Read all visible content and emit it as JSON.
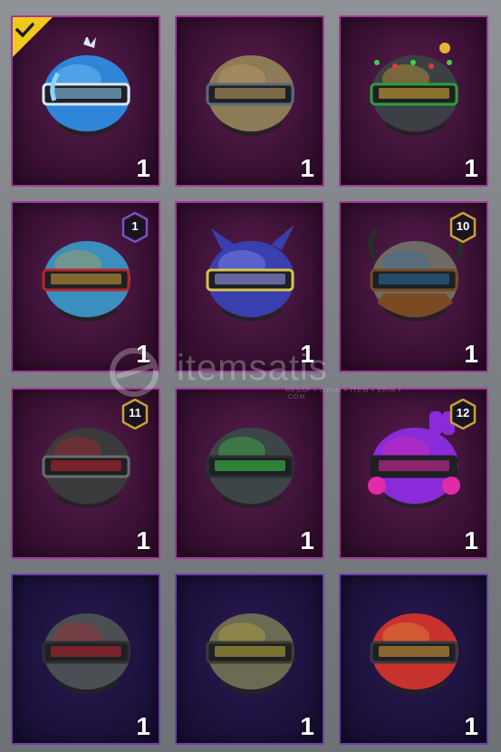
{
  "inventory": {
    "items": [
      {
        "name": "ice-helmet",
        "count": "1",
        "badge": "",
        "selected": true,
        "tone": "purple",
        "colors": {
          "main": "#2f86d8",
          "accent": "#8fd3ff",
          "trim": "#d9e8f5"
        }
      },
      {
        "name": "bronze-knight-helmet",
        "count": "1",
        "badge": "",
        "selected": false,
        "tone": "purple",
        "colors": {
          "main": "#8d7a57",
          "accent": "#c9a56a",
          "trim": "#5b6a78"
        }
      },
      {
        "name": "christmas-lights-helmet",
        "count": "1",
        "badge": "",
        "selected": false,
        "tone": "purple",
        "colors": {
          "main": "#3c3f44",
          "accent": "#e5b531",
          "trim": "#2f9e3a"
        }
      },
      {
        "name": "golden-pharaoh-helmet",
        "count": "1",
        "badge": "1",
        "badge_color": "#7a4fc2",
        "selected": false,
        "tone": "purple",
        "colors": {
          "main": "#3a8fbf",
          "accent": "#d6a23a",
          "trim": "#b8242a"
        }
      },
      {
        "name": "blue-samurai-helmet",
        "count": "1",
        "badge": "",
        "selected": false,
        "tone": "purple",
        "colors": {
          "main": "#3a3fb0",
          "accent": "#9ca0ff",
          "trim": "#d9c24a"
        }
      },
      {
        "name": "viking-helmet",
        "count": "1",
        "badge": "10",
        "badge_color": "#c9a234",
        "selected": false,
        "tone": "purple",
        "colors": {
          "main": "#6e6a64",
          "accent": "#2f6fa8",
          "trim": "#7a4a22"
        }
      },
      {
        "name": "black-raider-helmet",
        "count": "1",
        "badge": "11",
        "badge_color": "#c9a234",
        "selected": false,
        "tone": "purple",
        "colors": {
          "main": "#3a3a3c",
          "accent": "#c2222a",
          "trim": "#6b6b6d"
        }
      },
      {
        "name": "green-circuit-helmet",
        "count": "1",
        "badge": "",
        "selected": false,
        "tone": "purple",
        "colors": {
          "main": "#3d4547",
          "accent": "#3fd248",
          "trim": "#2a2f31"
        }
      },
      {
        "name": "bunny-helmet",
        "count": "1",
        "badge": "12",
        "badge_color": "#c9a234",
        "selected": false,
        "tone": "purple",
        "colors": {
          "main": "#8a2bd9",
          "accent": "#e22aa6",
          "trim": "#1e1e20"
        }
      },
      {
        "name": "red-skull-helmet",
        "count": "1",
        "badge": "",
        "selected": false,
        "tone": "blue",
        "colors": {
          "main": "#4b4e52",
          "accent": "#c0282f",
          "trim": "#2d2f31"
        }
      },
      {
        "name": "yellow-desert-helmet",
        "count": "1",
        "badge": "",
        "selected": false,
        "tone": "blue",
        "colors": {
          "main": "#6c6a52",
          "accent": "#c7b63a",
          "trim": "#3d3b2e"
        }
      },
      {
        "name": "firefighter-helmet",
        "count": "1",
        "badge": "",
        "selected": false,
        "tone": "blue",
        "colors": {
          "main": "#c8322d",
          "accent": "#e6a33a",
          "trim": "#3a3a3c"
        }
      }
    ]
  },
  "watermark": {
    "brand": "itemsatis",
    "sub": "HESAP • OYUN • ITEM • EPIN • .COM"
  }
}
